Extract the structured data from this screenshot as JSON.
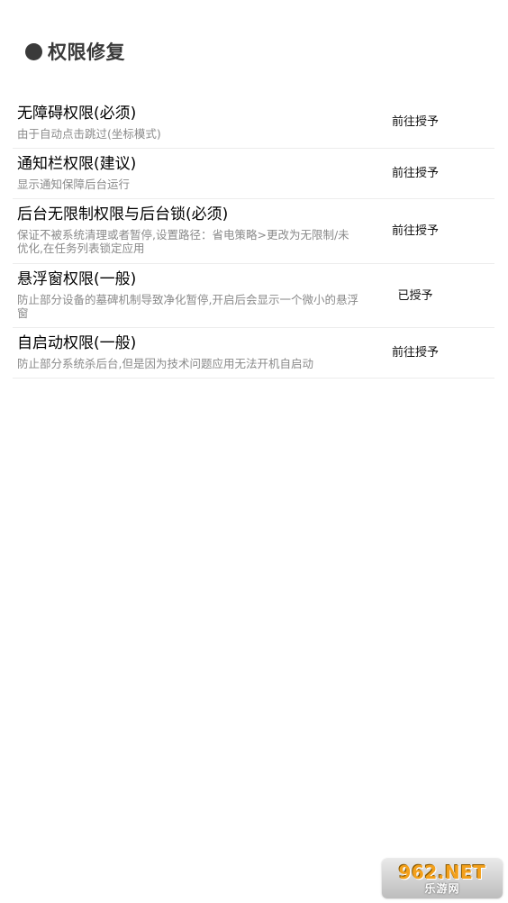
{
  "header": {
    "title": "权限修复"
  },
  "permissions": [
    {
      "title": "无障碍权限(必须)",
      "desc": "由于自动点击跳过(坐标模式)",
      "action": "前往授予"
    },
    {
      "title": "通知栏权限(建议)",
      "desc": "显示通知保障后台运行",
      "action": "前往授予"
    },
    {
      "title": "后台无限制权限与后台锁(必须)",
      "desc": "保证不被系统清理或者暂停,设置路径：省电策略>更改为无限制/未优化,在任务列表锁定应用",
      "action": "前往授予"
    },
    {
      "title": "悬浮窗权限(一般)",
      "desc": "防止部分设备的墓碑机制导致净化暂停,开启后会显示一个微小的悬浮窗",
      "action": "已授予"
    },
    {
      "title": "自启动权限(一般)",
      "desc": "防止部分系统杀后台,但是因为技术问题应用无法开机自启动",
      "action": "前往授予"
    }
  ],
  "watermark": {
    "top": "962.NET",
    "bottom": "乐游网"
  }
}
